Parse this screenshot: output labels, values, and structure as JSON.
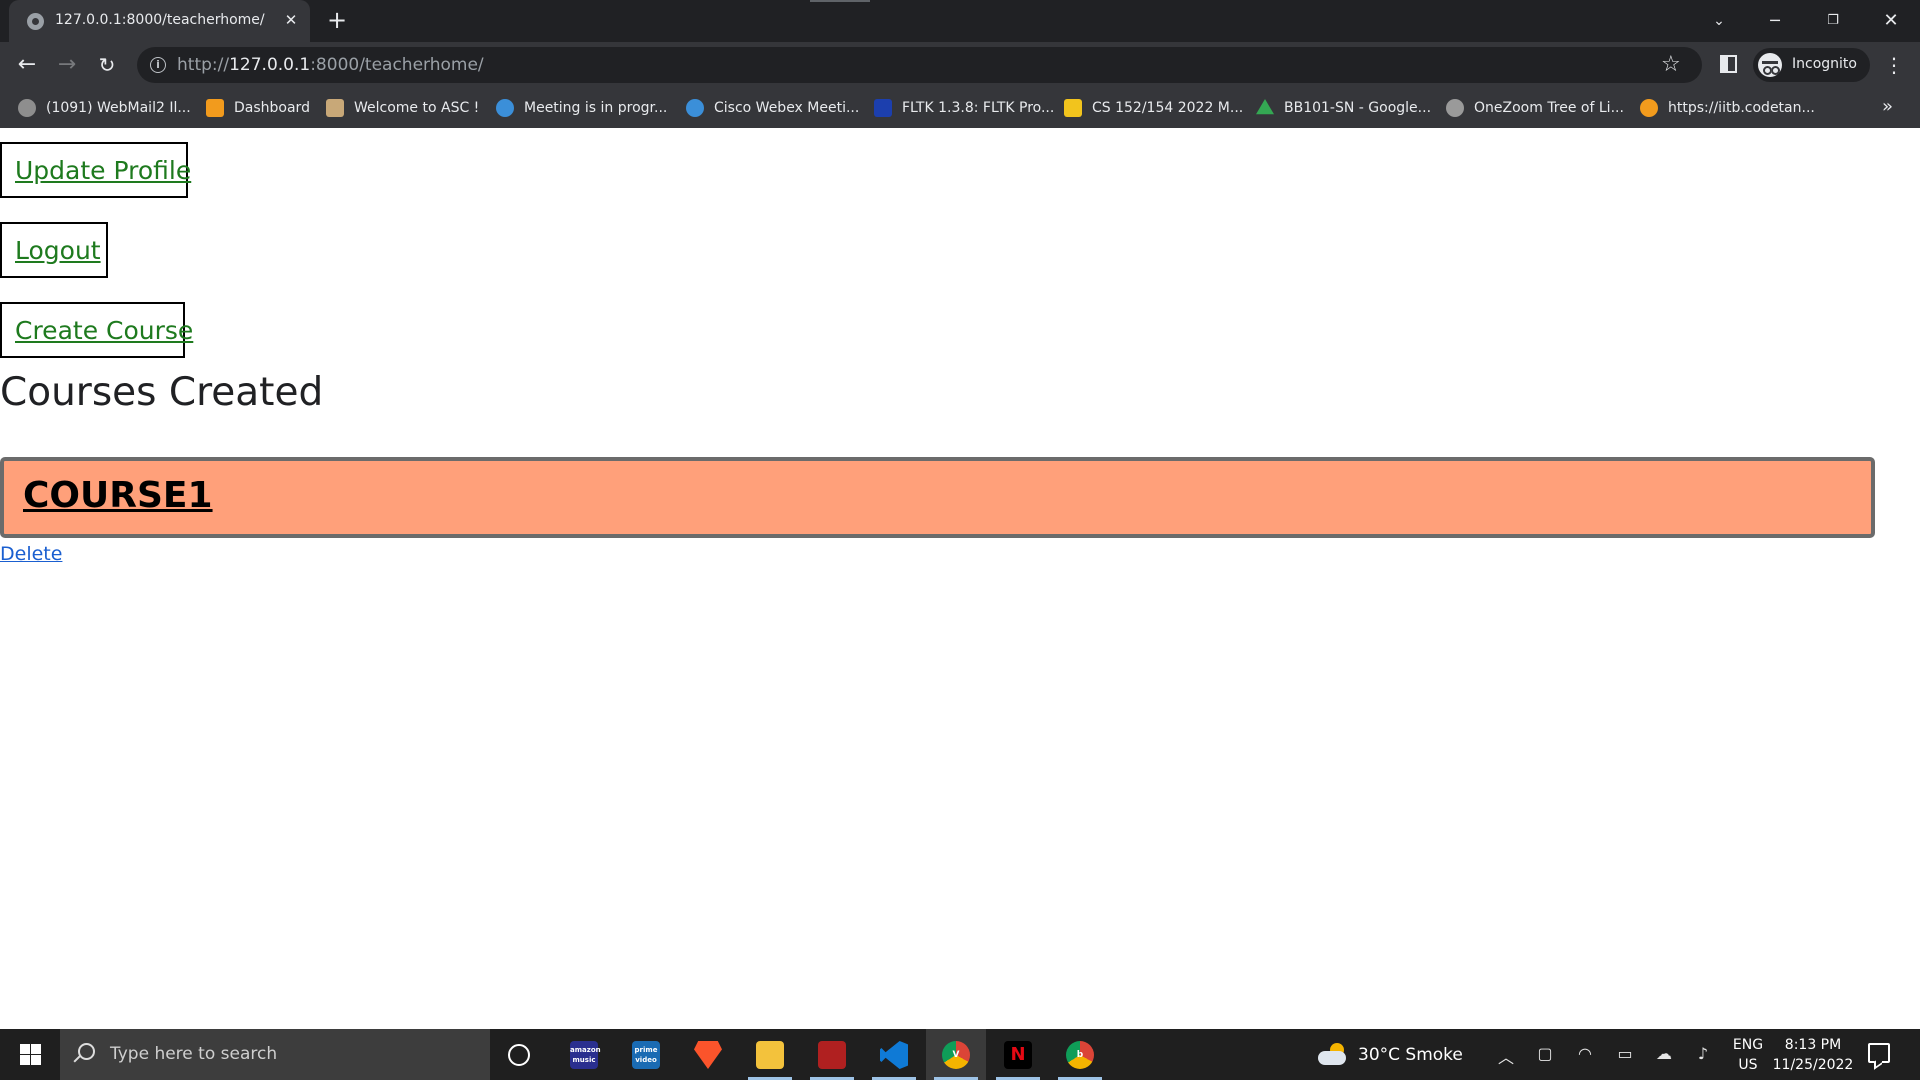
{
  "browser": {
    "tab_title": "127.0.0.1:8000/teacherhome/",
    "url_prefix": "http://",
    "url_host": "127.0.0.1",
    "url_rest": ":8000/teacherhome/",
    "profile_label": "Incognito",
    "new_tab_glyph": "+",
    "close_tab_glyph": "✕",
    "bookmarks": [
      {
        "label": "(1091) WebMail2 Il...",
        "color": "#8e8e8e"
      },
      {
        "label": "Dashboard",
        "color": "#f29b1d"
      },
      {
        "label": "Welcome to ASC !",
        "color": "#c8a878"
      },
      {
        "label": "Meeting is in progr...",
        "color": "#3b8fd9"
      },
      {
        "label": "Cisco Webex Meeti...",
        "color": "#3b8fd9"
      },
      {
        "label": "FLTK 1.3.8: FLTK Pro...",
        "color": "#1c3fae"
      },
      {
        "label": "CS 152/154 2022 M...",
        "color": "#f2c41d"
      },
      {
        "label": "BB101-SN - Google...",
        "color": "#34a853"
      },
      {
        "label": "OneZoom Tree of Li...",
        "color": "#9a9a9a"
      },
      {
        "label": "https://iitb.codetan...",
        "color": "#f29b1d"
      }
    ],
    "bookmarks_overflow": "»"
  },
  "page": {
    "buttons": {
      "update_profile": "Update Profile",
      "logout": "Logout",
      "create_course": "Create Course"
    },
    "heading": "Courses Created",
    "courses": [
      {
        "name": "COURSE1",
        "delete_label": "Delete"
      }
    ],
    "colors": {
      "link_green": "#1e7a1e",
      "course_card_bg": "#ffa07a",
      "delete_link": "#1a5fd0"
    }
  },
  "taskbar": {
    "search_placeholder": "Type here to search",
    "apps": [
      {
        "name": "amazon-music",
        "label": "amazon music",
        "color": "#2a2f8f"
      },
      {
        "name": "prime-video",
        "label": "prime video",
        "color": "#1a6bb3"
      },
      {
        "name": "brave",
        "label": "",
        "color": "#fb542b"
      },
      {
        "name": "file-explorer",
        "label": "",
        "color": "#f3c23c"
      },
      {
        "name": "app-5",
        "label": "",
        "color": "#b02020"
      },
      {
        "name": "vscode",
        "label": "",
        "color": "#0f7ad6"
      },
      {
        "name": "chrome-v",
        "label": "V",
        "color": "#db4437"
      },
      {
        "name": "netflix",
        "label": "N",
        "color": "#000000"
      },
      {
        "name": "chrome-b",
        "label": "b",
        "color": "#db4437"
      }
    ],
    "weather": "30°C  Smoke",
    "language": "ENG",
    "region": "US",
    "time": "8:13 PM",
    "date": "11/25/2022"
  }
}
